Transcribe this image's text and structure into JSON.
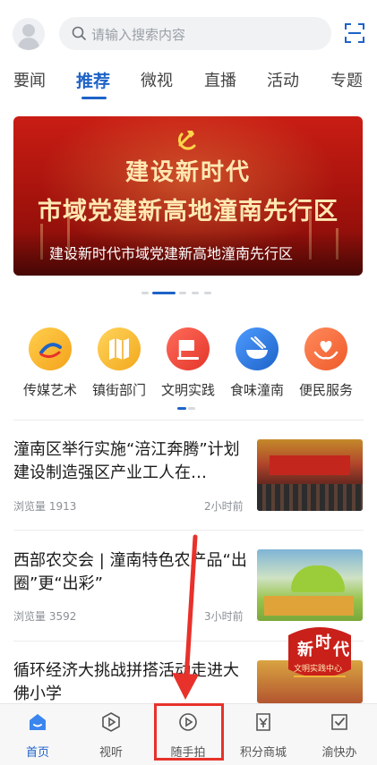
{
  "header": {
    "search_placeholder": "请输入搜索内容"
  },
  "tabs": [
    "要闻",
    "推荐",
    "微视",
    "直播",
    "活动",
    "专题"
  ],
  "active_tab": "推荐",
  "banner": {
    "line1": "建设新时代",
    "line2": "市域党建新高地潼南先行区",
    "caption": "建设新时代市域党建新高地潼南先行区"
  },
  "services": [
    {
      "label": "传媒艺术",
      "icon": "media-art-icon"
    },
    {
      "label": "镇街部门",
      "icon": "map-icon"
    },
    {
      "label": "文明实践",
      "icon": "flag-icon"
    },
    {
      "label": "食味潼南",
      "icon": "food-bowl-icon"
    },
    {
      "label": "便民服务",
      "icon": "heart-hand-icon"
    }
  ],
  "news": [
    {
      "title": "潼南区举行实施“涪江奔腾”计划建设制造强区产业工人在…",
      "views": "浏览量 1913",
      "time": "2小时前"
    },
    {
      "title": "西部农交会 | 潼南特色农产品“出圈”更“出彩”",
      "views": "浏览量 3592",
      "time": "3小时前"
    },
    {
      "title": "循环经济大挑战拼搭活动走进大佛小学",
      "views": "",
      "time": ""
    }
  ],
  "promo": {
    "text1": "新",
    "text2": "时",
    "text3": "代",
    "caption": "文明实践中心"
  },
  "bottom_nav": [
    {
      "label": "首页",
      "icon": "home-icon",
      "active": true
    },
    {
      "label": "视听",
      "icon": "play-circle-icon",
      "active": false
    },
    {
      "label": "随手拍",
      "icon": "camera-play-icon",
      "active": false
    },
    {
      "label": "积分商城",
      "icon": "points-mall-icon",
      "active": false
    },
    {
      "label": "渝快办",
      "icon": "check-clipboard-icon",
      "active": false
    }
  ],
  "colors": {
    "accent": "#1e63c8",
    "banner_red": "#b5160f",
    "annotation_red": "#e8312b"
  }
}
